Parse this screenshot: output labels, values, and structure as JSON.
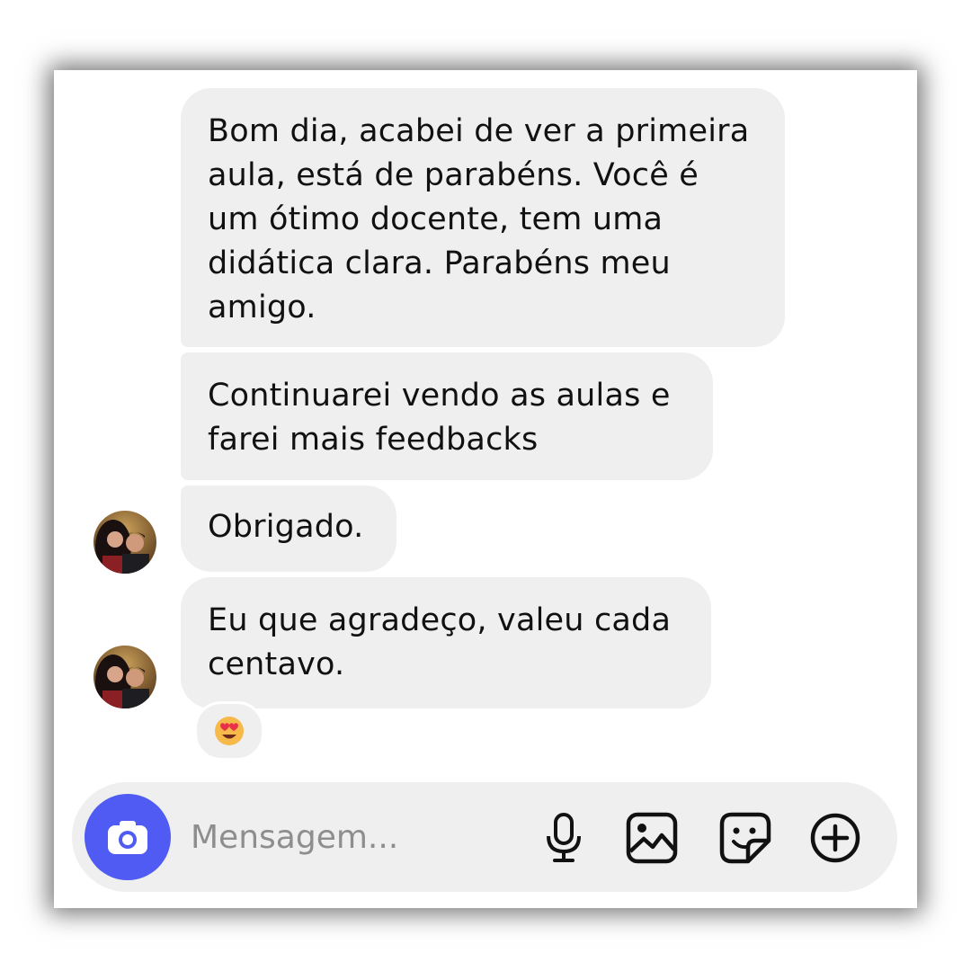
{
  "messages": [
    {
      "text": "Bom dia, acabei de ver a primeira\naula, está de parabéns. Você é\num ótimo docente, tem uma\ndidática clara. Parabéns meu\namigo."
    },
    {
      "text": "Continuarei vendo as aulas e\nfarei mais feedbacks"
    },
    {
      "text": "Obrigado."
    },
    {
      "text": "Eu que agradeço, valeu cada\ncentavo."
    }
  ],
  "reaction": {
    "emoji": "heart-eyes-icon"
  },
  "composer": {
    "placeholder": "Mensagem...",
    "icons": [
      "camera-icon",
      "microphone-icon",
      "gallery-icon",
      "sticker-icon",
      "plus-icon"
    ]
  },
  "colors": {
    "bubble": "#efefef",
    "camera_button": "#4f5bf3",
    "text": "#111111",
    "placeholder": "#8e8e8e"
  }
}
